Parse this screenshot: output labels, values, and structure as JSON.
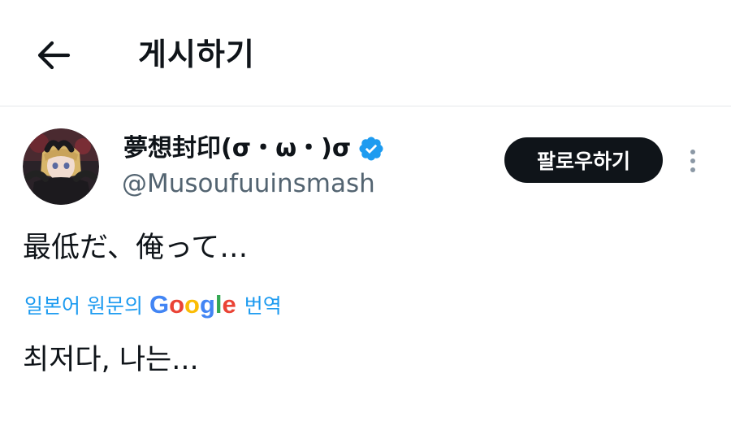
{
  "header": {
    "title": "게시하기",
    "back_icon": "arrow-left-icon"
  },
  "author": {
    "display_name": "夢想封印(σ・ω・)σ",
    "handle": "@Musoufuuinsmash",
    "verified_icon": "verified-badge-icon",
    "avatar_icon": "avatar"
  },
  "actions": {
    "follow_label": "팔로우하기",
    "more_icon": "more-vertical-icon"
  },
  "post": {
    "original_text": "最低だ、俺って…",
    "translate": {
      "prefix": "일본어 원문의",
      "google": [
        "G",
        "o",
        "o",
        "g",
        "l",
        "e"
      ],
      "suffix": "번역"
    },
    "translated_text": "최저다, 나는..."
  },
  "colors": {
    "link": "#1d9bf0",
    "text": "#0f1419",
    "secondary": "#536471",
    "button_bg": "#0f1419",
    "verified": "#1d9bf0"
  }
}
